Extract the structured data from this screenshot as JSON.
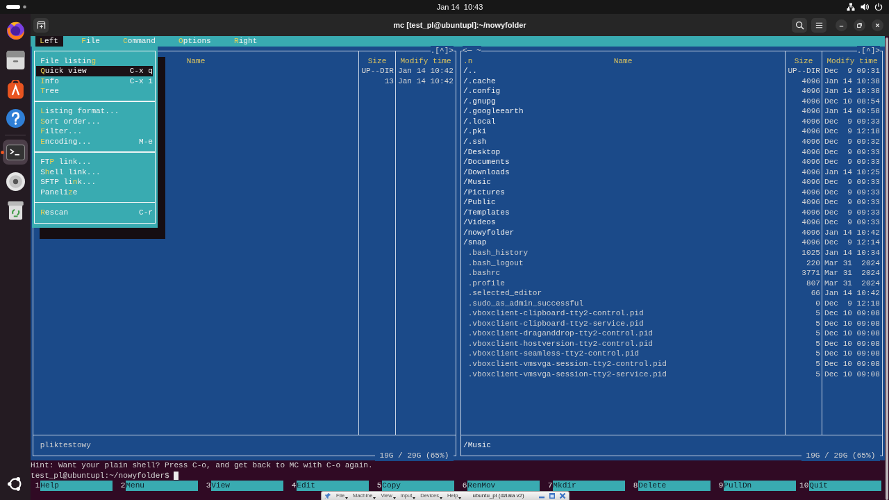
{
  "top_bar": {
    "clock": "Jan 14  10:43"
  },
  "dock": {
    "groups": [
      [
        {
          "kind": "browser",
          "active": false
        },
        {
          "kind": "files",
          "active": false
        },
        {
          "kind": "store",
          "active": false
        },
        {
          "kind": "help",
          "active": false
        }
      ],
      [
        {
          "kind": "terminal",
          "active": true
        },
        {
          "kind": "disc",
          "active": false
        },
        {
          "kind": "trash",
          "active": false
        }
      ]
    ]
  },
  "window": {
    "title": "mc [test_pl@ubuntupl]:~/nowyfolder"
  },
  "menu_bar": [
    {
      "hotkey": "L",
      "after": "eft",
      "selected": true
    },
    {
      "hotkey": "F",
      "after": "ile",
      "selected": false
    },
    {
      "hotkey": "C",
      "after": "ommand",
      "selected": false
    },
    {
      "hotkey": "O",
      "after": "ptions",
      "selected": false
    },
    {
      "hotkey": "R",
      "after": "ight",
      "selected": false
    }
  ],
  "dropdown": {
    "sections": [
      [
        {
          "before": "File listin",
          "hotkey": "g",
          "selected": false
        },
        {
          "hotkey": "Q",
          "after": "uick view",
          "shortcut": "C-x q",
          "selected": true
        },
        {
          "hotkey": "I",
          "after": "nfo",
          "shortcut": "C-x i",
          "selected": false
        },
        {
          "hotkey": "T",
          "after": "ree",
          "selected": false
        }
      ],
      [
        {
          "hotkey": "L",
          "after": "isting format...",
          "selected": false
        },
        {
          "hotkey": "S",
          "after": "ort order...",
          "selected": false
        },
        {
          "hotkey": "F",
          "after": "ilter...",
          "selected": false
        },
        {
          "hotkey": "E",
          "after": "ncoding...",
          "shortcut": "M-e",
          "selected": false
        }
      ],
      [
        {
          "before": "FT",
          "hotkey": "P",
          "after": " link...",
          "selected": false
        },
        {
          "before": "S",
          "hotkey": "h",
          "after": "ell link...",
          "selected": false
        },
        {
          "before": "SFTP li",
          "hotkey": "n",
          "after": "k...",
          "selected": false
        },
        {
          "before": "Paneli",
          "hotkey": "z",
          "after": "e",
          "selected": false
        }
      ],
      [
        {
          "hotkey": "R",
          "after": "escan",
          "shortcut": "C-r",
          "selected": false
        }
      ]
    ]
  },
  "left_panel": {
    "top_right": ".[^]>",
    "columns": [
      "Name",
      "Size",
      "Modify time"
    ],
    "rows": [
      {
        "size": "UP--DIR",
        "modified": "Jan 14 10:42"
      },
      {
        "size": "13",
        "modified": "Jan 14 10:42"
      }
    ],
    "mini_status": {
      "name": "pliktestowy",
      "kind": "file"
    },
    "disk_usage": "19G / 29G (65%)"
  },
  "right_panel": {
    "top_left": "<─ ~",
    "top_right": ".[^]>",
    "sort_mark": ".n",
    "columns": [
      "Name",
      "Size",
      "Modify time"
    ],
    "rows": [
      {
        "name": "/..",
        "kind": "dir",
        "size": "UP--DIR",
        "modified": "Dec  9 09:31"
      },
      {
        "name": "/.cache",
        "kind": "dir",
        "size": "4096",
        "modified": "Jan 14 10:38"
      },
      {
        "name": "/.config",
        "kind": "dir",
        "size": "4096",
        "modified": "Jan 14 10:38"
      },
      {
        "name": "/.gnupg",
        "kind": "dir",
        "size": "4096",
        "modified": "Dec 10 08:54"
      },
      {
        "name": "/.googleearth",
        "kind": "dir",
        "size": "4096",
        "modified": "Jan 14 09:58"
      },
      {
        "name": "/.local",
        "kind": "dir",
        "size": "4096",
        "modified": "Dec  9 09:33"
      },
      {
        "name": "/.pki",
        "kind": "dir",
        "size": "4096",
        "modified": "Dec  9 12:18"
      },
      {
        "name": "/.ssh",
        "kind": "dir",
        "size": "4096",
        "modified": "Dec  9 09:32"
      },
      {
        "name": "/Desktop",
        "kind": "dir",
        "size": "4096",
        "modified": "Dec  9 09:33"
      },
      {
        "name": "/Documents",
        "kind": "dir",
        "size": "4096",
        "modified": "Dec  9 09:33"
      },
      {
        "name": "/Downloads",
        "kind": "dir",
        "size": "4096",
        "modified": "Jan 14 10:25"
      },
      {
        "name": "/Music",
        "kind": "dir",
        "size": "4096",
        "modified": "Dec  9 09:33"
      },
      {
        "name": "/Pictures",
        "kind": "dir",
        "size": "4096",
        "modified": "Dec  9 09:33"
      },
      {
        "name": "/Public",
        "kind": "dir",
        "size": "4096",
        "modified": "Dec  9 09:33"
      },
      {
        "name": "/Templates",
        "kind": "dir",
        "size": "4096",
        "modified": "Dec  9 09:33"
      },
      {
        "name": "/Videos",
        "kind": "dir",
        "size": "4096",
        "modified": "Dec  9 09:33"
      },
      {
        "name": "/nowyfolder",
        "kind": "dir",
        "size": "4096",
        "modified": "Jan 14 10:42"
      },
      {
        "name": "/snap",
        "kind": "dir",
        "size": "4096",
        "modified": "Dec  9 12:14"
      },
      {
        "name": ".bash_history",
        "kind": "file",
        "size": "1025",
        "modified": "Jan 14 10:34"
      },
      {
        "name": ".bash_logout",
        "kind": "file",
        "size": "220",
        "modified": "Mar 31  2024"
      },
      {
        "name": ".bashrc",
        "kind": "file",
        "size": "3771",
        "modified": "Mar 31  2024"
      },
      {
        "name": ".profile",
        "kind": "file",
        "size": "807",
        "modified": "Mar 31  2024"
      },
      {
        "name": ".selected_editor",
        "kind": "file",
        "size": "66",
        "modified": "Jan 14 10:42"
      },
      {
        "name": ".sudo_as_admin_successful",
        "kind": "file",
        "size": "0",
        "modified": "Dec  9 12:18"
      },
      {
        "name": ".vboxclient-clipboard-tty2-control.pid",
        "kind": "file",
        "size": "5",
        "modified": "Dec 10 09:08"
      },
      {
        "name": ".vboxclient-clipboard-tty2-service.pid",
        "kind": "file",
        "size": "5",
        "modified": "Dec 10 09:08"
      },
      {
        "name": ".vboxclient-draganddrop-tty2-control.pid",
        "kind": "file",
        "size": "5",
        "modified": "Dec 10 09:08"
      },
      {
        "name": ".vboxclient-hostversion-tty2-control.pid",
        "kind": "file",
        "size": "5",
        "modified": "Dec 10 09:08"
      },
      {
        "name": ".vboxclient-seamless-tty2-control.pid",
        "kind": "file",
        "size": "5",
        "modified": "Dec 10 09:08"
      },
      {
        "name": ".vboxclient-vmsvga-session-tty2-control.pid",
        "kind": "file",
        "size": "5",
        "modified": "Dec 10 09:08"
      },
      {
        "name": ".vboxclient-vmsvga-session-tty2-service.pid",
        "kind": "file",
        "size": "5",
        "modified": "Dec 10 09:08"
      }
    ],
    "mini_status": {
      "name": "/Music",
      "kind": "dir"
    },
    "disk_usage": "19G / 29G (65%)"
  },
  "hint": "Hint: Want your plain shell? Press C-o, and get back to MC with C-o again.",
  "prompt": "test_pl@ubuntupl:~/nowyfolder$",
  "function_keys": [
    {
      "number": "1",
      "label": "Help"
    },
    {
      "number": "2",
      "label": "Menu"
    },
    {
      "number": "3",
      "label": "View"
    },
    {
      "number": "4",
      "label": "Edit"
    },
    {
      "number": "5",
      "label": "Copy"
    },
    {
      "number": "6",
      "label": "RenMov"
    },
    {
      "number": "7",
      "label": "Mkdir"
    },
    {
      "number": "8",
      "label": "Delete"
    },
    {
      "number": "9",
      "label": "PullDn"
    },
    {
      "number": "10",
      "label": "Quit"
    }
  ],
  "vm_toolbar": {
    "menus": [
      "File",
      "Machine",
      "View",
      "Input",
      "Devices",
      "Help"
    ],
    "title": "ubuntu_pl (dziala v2)"
  }
}
